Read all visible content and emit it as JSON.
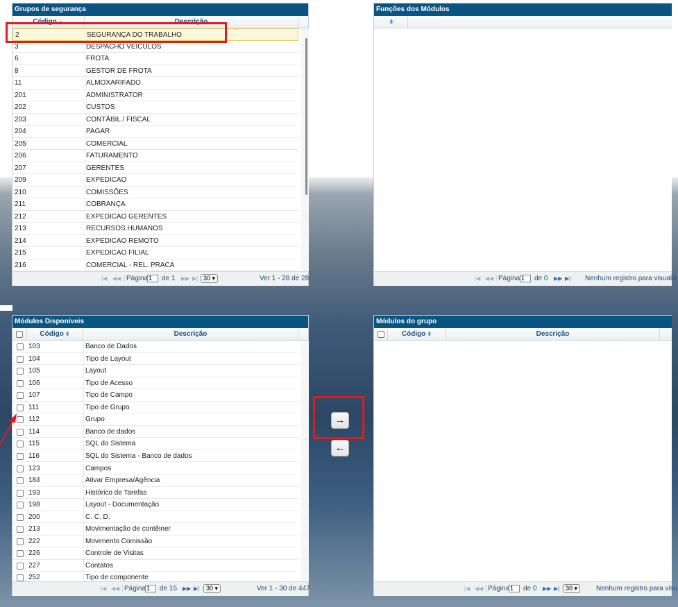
{
  "grupos": {
    "title": "Grupos de segurança",
    "columns": {
      "codigo": "Código",
      "descricao": "Descrição"
    },
    "rows": [
      {
        "codigo": "2",
        "descricao": "SEGURANÇA DO TRABALHO"
      },
      {
        "codigo": "3",
        "descricao": "DESPACHO VEICULOS"
      },
      {
        "codigo": "6",
        "descricao": "FROTA"
      },
      {
        "codigo": "8",
        "descricao": "GESTOR DE FROTA"
      },
      {
        "codigo": "11",
        "descricao": "ALMOXARIFADO"
      },
      {
        "codigo": "201",
        "descricao": "ADMINISTRATOR"
      },
      {
        "codigo": "202",
        "descricao": "CUSTOS"
      },
      {
        "codigo": "203",
        "descricao": "CONTÁBIL / FISCAL"
      },
      {
        "codigo": "204",
        "descricao": "PAGAR"
      },
      {
        "codigo": "205",
        "descricao": "COMERCIAL"
      },
      {
        "codigo": "206",
        "descricao": "FATURAMENTO"
      },
      {
        "codigo": "207",
        "descricao": "GERENTES"
      },
      {
        "codigo": "209",
        "descricao": "EXPEDICAO"
      },
      {
        "codigo": "210",
        "descricao": "COMISSÕES"
      },
      {
        "codigo": "211",
        "descricao": "COBRANÇA"
      },
      {
        "codigo": "212",
        "descricao": "EXPEDICAO GERENTES"
      },
      {
        "codigo": "213",
        "descricao": "RECURSOS HUMANOS"
      },
      {
        "codigo": "214",
        "descricao": "EXPEDICAO REMOTO"
      },
      {
        "codigo": "215",
        "descricao": "EXPEDICAO FILIAL"
      },
      {
        "codigo": "216",
        "descricao": "COMERCIAL - REL. PRACA"
      }
    ],
    "pager": {
      "label": "Página",
      "page": "1",
      "of": "de 1",
      "per_page": "30",
      "info": "Ver 1 - 28 de 28"
    }
  },
  "funcoes": {
    "title": "Funções dos Módulos",
    "pager": {
      "label": "Página",
      "page": "1",
      "of": "de 0",
      "info": "Nenhum registro para visualiz"
    }
  },
  "disponiveis": {
    "title": "Módulos Disponíveis",
    "columns": {
      "codigo": "Código",
      "descricao": "Descrição"
    },
    "rows": [
      {
        "codigo": "103",
        "descricao": "Banco de Dados"
      },
      {
        "codigo": "104",
        "descricao": "Tipo de Layout"
      },
      {
        "codigo": "105",
        "descricao": "Layout"
      },
      {
        "codigo": "106",
        "descricao": "Tipo de Acesso"
      },
      {
        "codigo": "107",
        "descricao": "Tipo de Campo"
      },
      {
        "codigo": "111",
        "descricao": "Tipo de Grupo"
      },
      {
        "codigo": "112",
        "descricao": "Grupo"
      },
      {
        "codigo": "114",
        "descricao": "Banco de dados"
      },
      {
        "codigo": "115",
        "descricao": "SQL do Sistema"
      },
      {
        "codigo": "116",
        "descricao": "SQL do Sistema - Banco de dados"
      },
      {
        "codigo": "123",
        "descricao": "Campos"
      },
      {
        "codigo": "184",
        "descricao": "Ativar Empresa/Agência"
      },
      {
        "codigo": "193",
        "descricao": "Histórico de Tarefas"
      },
      {
        "codigo": "198",
        "descricao": "Layout - Documentação"
      },
      {
        "codigo": "200",
        "descricao": "C. C. D."
      },
      {
        "codigo": "213",
        "descricao": "Movimentação de contêiner"
      },
      {
        "codigo": "222",
        "descricao": "Movimento Comissão"
      },
      {
        "codigo": "226",
        "descricao": "Controle de Visitas"
      },
      {
        "codigo": "227",
        "descricao": "Contatos"
      },
      {
        "codigo": "252",
        "descricao": "Tipo de componente"
      }
    ],
    "pager": {
      "label": "Página",
      "page": "1",
      "of": "de 15",
      "per_page": "30",
      "info": "Ver 1 - 30 de 447"
    }
  },
  "grupo_modulos": {
    "title": "Módulos do grupo",
    "columns": {
      "codigo": "Código",
      "descricao": "Descrição"
    },
    "pager": {
      "label": "Página",
      "page": "1",
      "of": "de 0",
      "per_page": "30",
      "info": "Nenhum registro para visu"
    }
  },
  "actions": {
    "add": "→",
    "remove": "←"
  },
  "colors": {
    "header": "#0a5482",
    "highlight": "#e41a1a",
    "selected_row": "#fdf8dc"
  }
}
